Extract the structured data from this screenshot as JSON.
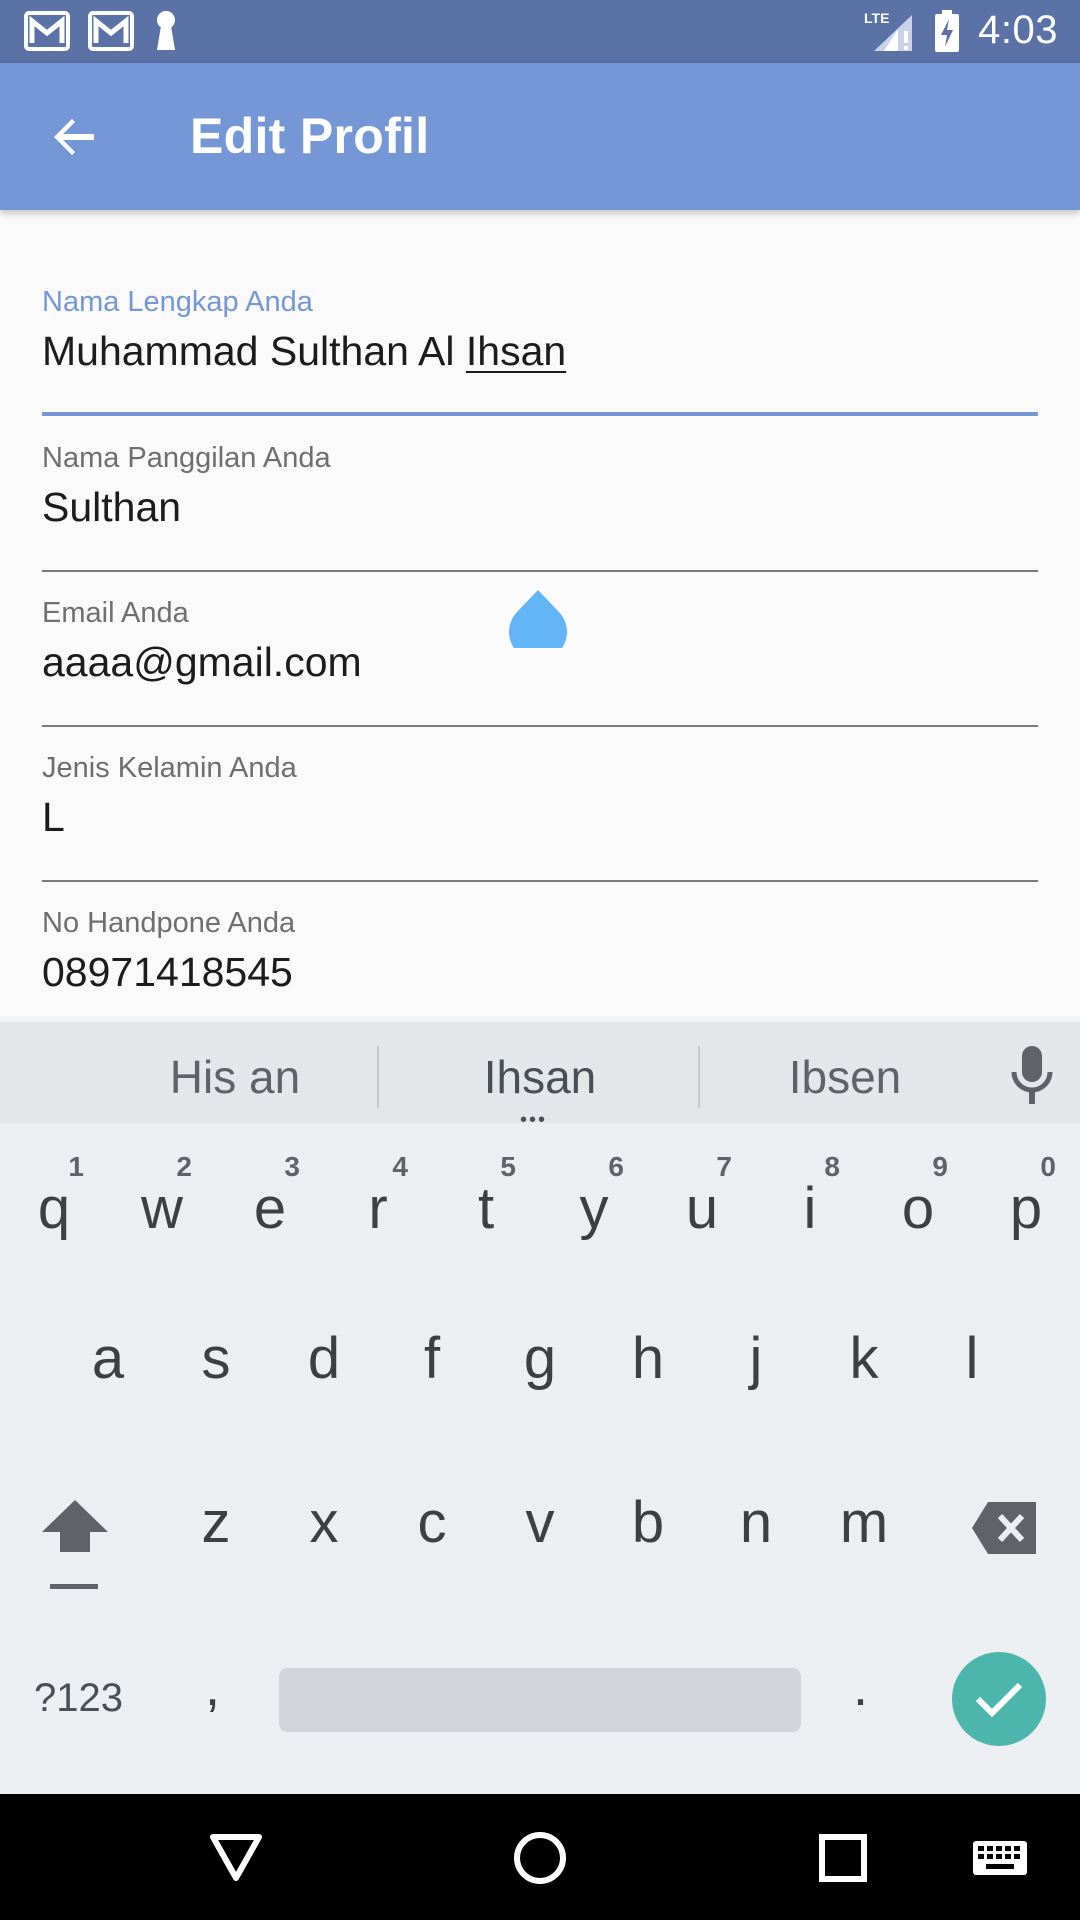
{
  "status_bar": {
    "time": "4:03",
    "network": "LTE",
    "icons": [
      "gmail-icon",
      "gmail-icon",
      "keyhole-icon",
      "lte-signal-icon",
      "battery-charging-icon"
    ]
  },
  "app_bar": {
    "title": "Edit Profil",
    "back_icon": "arrow-back-icon"
  },
  "form": {
    "fields": [
      {
        "label": "Nama Lengkap Anda",
        "value_prefix": "Muhammad Sulthan Al ",
        "value_underlined": "Ihsan",
        "focused": true
      },
      {
        "label": "Nama Panggilan Anda",
        "value": "Sulthan"
      },
      {
        "label": "Email Anda",
        "value": "aaaa@gmail.com"
      },
      {
        "label": "Jenis Kelamin Anda",
        "value": "L"
      },
      {
        "label": "No Handpone Anda",
        "value": "08971418545"
      }
    ]
  },
  "keyboard": {
    "suggestions": [
      "His an",
      "Ihsan",
      "Ibsen"
    ],
    "rows": [
      [
        {
          "k": "q",
          "h": "1"
        },
        {
          "k": "w",
          "h": "2"
        },
        {
          "k": "e",
          "h": "3"
        },
        {
          "k": "r",
          "h": "4"
        },
        {
          "k": "t",
          "h": "5"
        },
        {
          "k": "y",
          "h": "6"
        },
        {
          "k": "u",
          "h": "7"
        },
        {
          "k": "i",
          "h": "8"
        },
        {
          "k": "o",
          "h": "9"
        },
        {
          "k": "p",
          "h": "0"
        }
      ],
      [
        {
          "k": "a"
        },
        {
          "k": "s"
        },
        {
          "k": "d"
        },
        {
          "k": "f"
        },
        {
          "k": "g"
        },
        {
          "k": "h"
        },
        {
          "k": "j"
        },
        {
          "k": "k"
        },
        {
          "k": "l"
        }
      ],
      [
        {
          "k": "z"
        },
        {
          "k": "x"
        },
        {
          "k": "c"
        },
        {
          "k": "v"
        },
        {
          "k": "b"
        },
        {
          "k": "n"
        },
        {
          "k": "m"
        }
      ]
    ],
    "symbols_label": "?123",
    "comma": ",",
    "period": ".",
    "done_icon": "check-icon",
    "accent_color": "#4db6ac"
  },
  "colors": {
    "status_bar": "#5a72a6",
    "app_bar": "#7597d6",
    "cursor_handle": "#64b5f6"
  }
}
